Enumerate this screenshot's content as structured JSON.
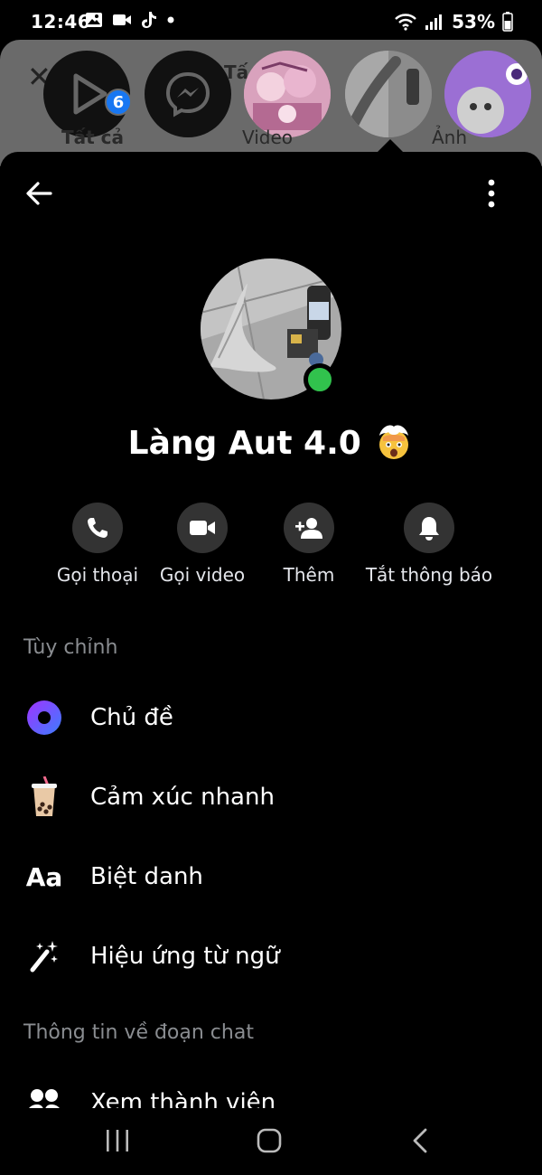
{
  "status_bar": {
    "time": "12:46",
    "battery": "53%",
    "icons_left": [
      "gallery-icon",
      "video-camera-icon",
      "tiktok-icon",
      "dot-icon"
    ],
    "icons_right": [
      "wifi-icon",
      "signal-icon",
      "battery-icon"
    ]
  },
  "background_sheet": {
    "badge_count": "6",
    "partial_title": "Tấ",
    "tab_labels": [
      "Tất cả",
      "Video",
      "Ảnh"
    ]
  },
  "chat_info": {
    "group_name": "Làng Aut 4.0",
    "online": true,
    "actions": [
      {
        "label": "Gọi thoại",
        "icon": "phone-icon"
      },
      {
        "label": "Gọi video",
        "icon": "video-icon"
      },
      {
        "label": "Thêm",
        "icon": "add-person-icon"
      },
      {
        "label": "Tắt thông báo",
        "icon": "bell-icon"
      }
    ],
    "section_customize": "Tùy chỉnh",
    "customize_items": [
      {
        "label": "Chủ đề",
        "icon": "theme-icon"
      },
      {
        "label": "Cảm xúc nhanh",
        "icon": "bubble-tea-icon"
      },
      {
        "label": "Biệt danh",
        "icon": "nickname-icon",
        "icon_text": "Aa"
      },
      {
        "label": "Hiệu ứng từ ngữ",
        "icon": "magic-wand-icon"
      }
    ],
    "section_chat_info": "Thông tin về đoạn chat",
    "chat_info_items": [
      {
        "label": "Xem thành viên",
        "icon": "members-icon"
      }
    ]
  },
  "colors": {
    "accent_blue": "#1877f2",
    "online_green": "#31c24d",
    "action_circle": "#333333",
    "muted_text": "#8a8d91"
  }
}
